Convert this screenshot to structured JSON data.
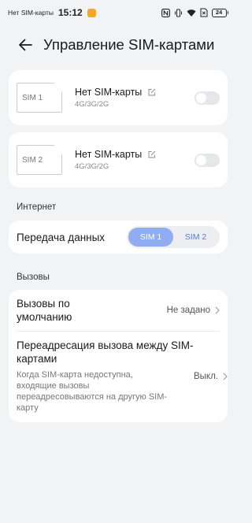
{
  "status_bar": {
    "carrier": "Нет SIM-карты",
    "time": "15:12",
    "battery": "24"
  },
  "header": {
    "title": "Управление SIM-картами"
  },
  "sims": [
    {
      "thumb_label": "SIM 1",
      "name": "Нет SIM-карты",
      "network": "4G/3G/2G"
    },
    {
      "thumb_label": "SIM 2",
      "name": "Нет SIM-карты",
      "network": "4G/3G/2G"
    }
  ],
  "internet": {
    "section_label": "Интернет",
    "data_label": "Передача данных",
    "options": [
      "SIM 1",
      "SIM 2"
    ],
    "selected": "SIM 1"
  },
  "calls": {
    "section_label": "Вызовы",
    "default_calls_label": "Вызовы по умолчанию",
    "default_calls_value": "Не задано",
    "forwarding_label": "Переадресация вызова между SIM-картами",
    "forwarding_desc": "Когда SIM-карта недоступна, входящие вызовы переадресовываются на другую SIM-карту",
    "forwarding_value": "Выкл."
  }
}
